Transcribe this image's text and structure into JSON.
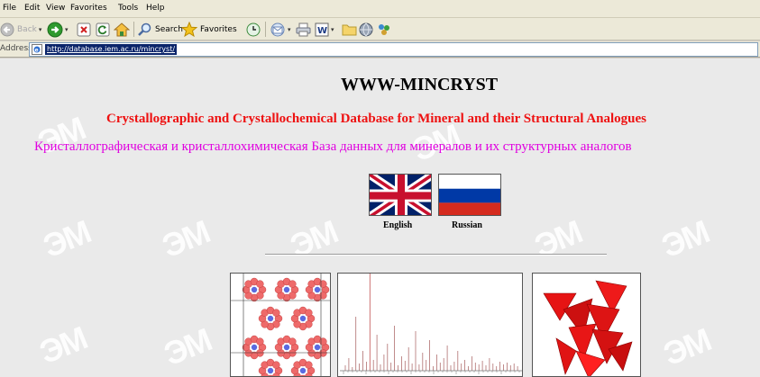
{
  "menu": [
    "File",
    "Edit",
    "View",
    "Favorites",
    "Tools",
    "Help"
  ],
  "toolbar": {
    "back": "Back",
    "search": "Search",
    "favorites": "Favorites"
  },
  "address": {
    "label": "Address",
    "url": "http://database.iem.ac.ru/mincryst/"
  },
  "page": {
    "title": "WWW-MINCRYST",
    "subtitle_en": "Crystallographic and Crystallochemical Database for Mineral and their Structural Analogues",
    "subtitle_ru": "Кристаллографическая и кристаллохимическая База данных для минералов и их структурных аналогов",
    "lang_english": "English",
    "lang_russian": "Russian",
    "watermark": "ЭМ"
  },
  "colors": {
    "subtitle_en": "#ee1111",
    "subtitle_ru": "#e000e0",
    "selection": "#0a246a"
  }
}
